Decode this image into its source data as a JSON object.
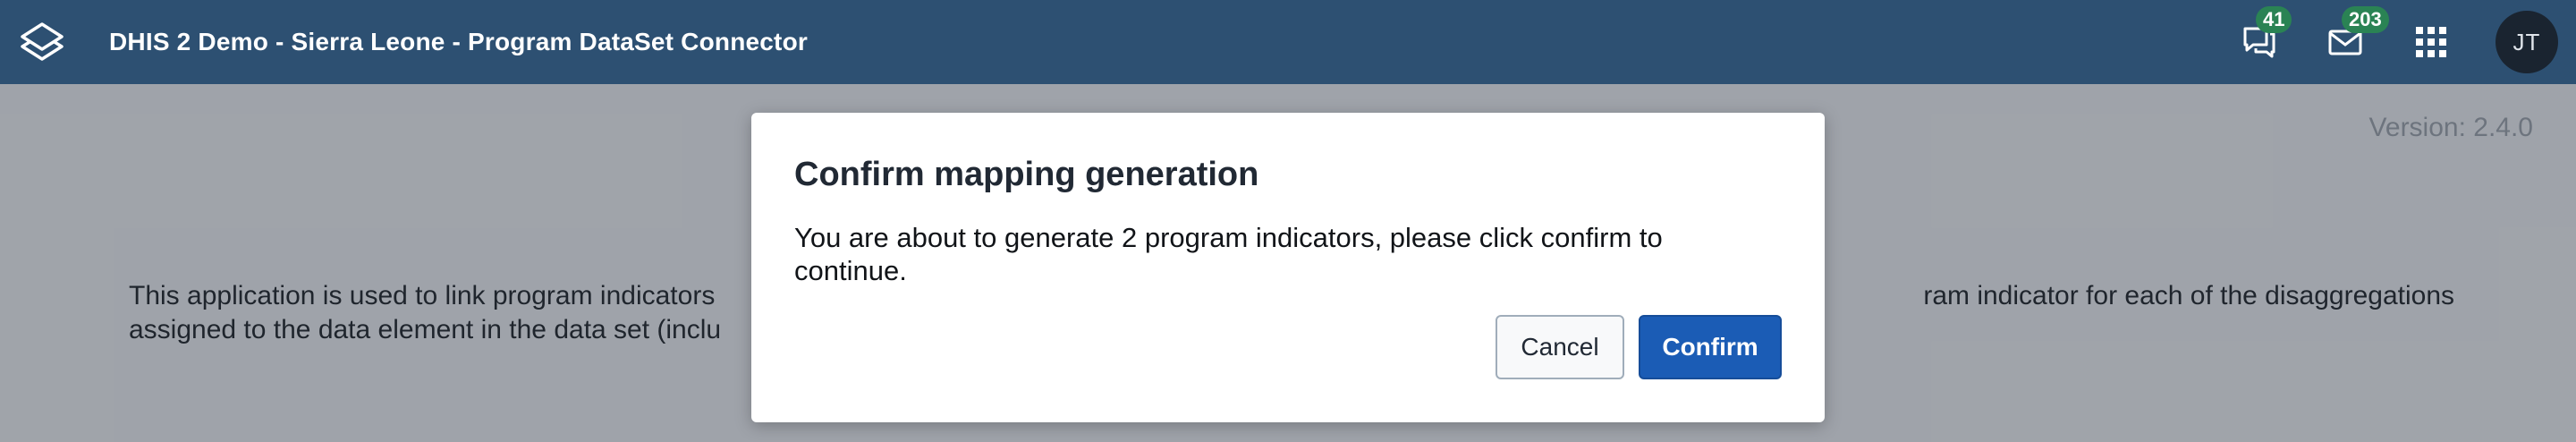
{
  "header": {
    "title": "DHIS 2 Demo - Sierra Leone - Program DataSet Connector",
    "interpretations_count": "41",
    "messages_count": "203",
    "avatar_initials": "JT"
  },
  "page": {
    "version": "Version: 2.4.0",
    "description_line1": "This application is used to link program indicators",
    "description_line1_tail": "ram indicator for each of the disaggregations",
    "description_line2": "assigned to the data element in the data set (inclu"
  },
  "modal": {
    "title": "Confirm mapping generation",
    "body": "You are about to generate 2 program indicators, please click confirm to continue.",
    "cancel_label": "Cancel",
    "confirm_label": "Confirm"
  },
  "colors": {
    "header_bg": "#2d5072",
    "badge_bg": "#2a8354",
    "primary": "#1b5cb5"
  }
}
